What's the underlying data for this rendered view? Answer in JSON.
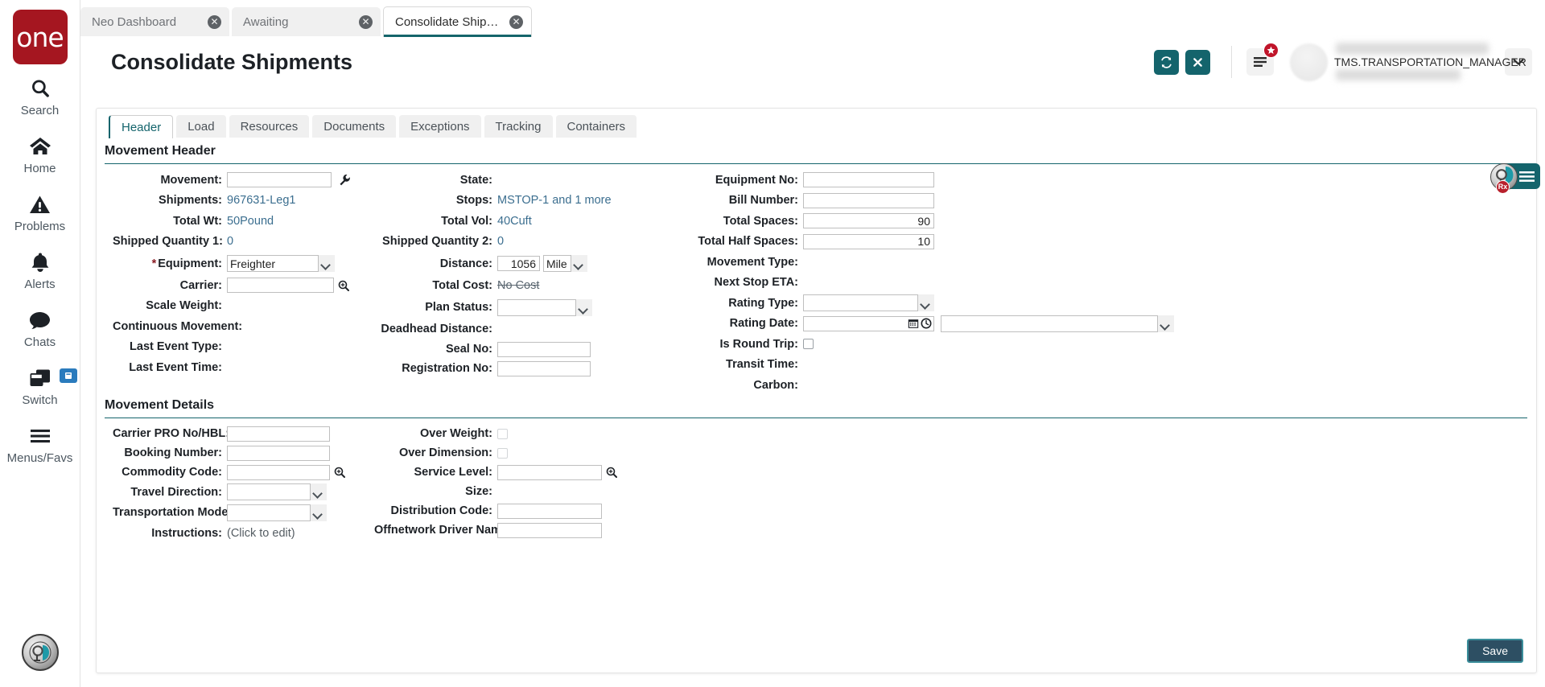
{
  "app": {
    "logo_text": "one",
    "window_title": "Consolidate Shipments"
  },
  "browser_tabs": [
    {
      "label": "Neo Dashboard",
      "active": false,
      "close": "✕"
    },
    {
      "label": "Awaiting",
      "active": false,
      "close": "✕"
    },
    {
      "label": "Consolidate Shipments",
      "active": true,
      "close": "✕"
    }
  ],
  "rail": {
    "items": [
      {
        "label": "Search",
        "icon": "search-icon"
      },
      {
        "label": "Home",
        "icon": "home-icon"
      },
      {
        "label": "Problems",
        "icon": "warning-triangle-icon"
      },
      {
        "label": "Alerts",
        "icon": "bell-icon"
      },
      {
        "label": "Chats",
        "icon": "chat-bubble-icon"
      },
      {
        "label": "Switch",
        "icon": "switch-windows-icon"
      },
      {
        "label": "Menus/Favs",
        "icon": "hamburger-icon"
      }
    ]
  },
  "header": {
    "title": "Consolidate Shipments",
    "refresh_icon": "refresh-icon",
    "close_icon": "close-icon",
    "menu_icon": "list-menu-icon",
    "menu_badge_icon": "star-badge-icon",
    "username": "TMS.TRANSPORTATION_MANAGER",
    "caret_icon": "chevron-down-icon"
  },
  "tabs": [
    {
      "label": "Header",
      "active": true
    },
    {
      "label": "Load",
      "active": false
    },
    {
      "label": "Resources",
      "active": false
    },
    {
      "label": "Documents",
      "active": false
    },
    {
      "label": "Exceptions",
      "active": false
    },
    {
      "label": "Tracking",
      "active": false
    },
    {
      "label": "Containers",
      "active": false
    }
  ],
  "movement_header": {
    "section_title": "Movement Header",
    "col1": {
      "movement_label": "Movement:",
      "movement_value": "",
      "shipments_label": "Shipments:",
      "shipments_value": "967631-Leg1",
      "total_wt_label": "Total Wt:",
      "total_wt_value": "50",
      "total_wt_unit": "Pound",
      "shipped_qty1_label": "Shipped Quantity 1:",
      "shipped_qty1_value": "0",
      "equipment_label": "Equipment:",
      "equipment_required": "*",
      "equipment_value": "Freighter",
      "carrier_label": "Carrier:",
      "carrier_value": "",
      "scale_weight_label": "Scale Weight:",
      "scale_weight_value": "",
      "continuous_movement_label": "Continuous Movement:",
      "continuous_movement_value": "",
      "last_event_type_label": "Last Event Type:",
      "last_event_type_value": "",
      "last_event_time_label": "Last Event Time:",
      "last_event_time_value": ""
    },
    "col2": {
      "state_label": "State:",
      "state_value": "",
      "stops_label": "Stops:",
      "stops_value": "MSTOP-1 and 1 more",
      "total_vol_label": "Total Vol:",
      "total_vol_value": "40",
      "total_vol_unit": "Cuft",
      "shipped_qty2_label": "Shipped Quantity 2:",
      "shipped_qty2_value": "0",
      "distance_label": "Distance:",
      "distance_value": "1056",
      "distance_unit": "Mile",
      "total_cost_label": "Total Cost:",
      "total_cost_value": "No Cost",
      "plan_status_label": "Plan Status:",
      "plan_status_value": "",
      "deadhead_distance_label": "Deadhead Distance:",
      "deadhead_distance_value": "",
      "seal_no_label": "Seal No:",
      "seal_no_value": "",
      "registration_no_label": "Registration No:",
      "registration_no_value": ""
    },
    "col3": {
      "equipment_no_label": "Equipment No:",
      "equipment_no_value": "",
      "bill_number_label": "Bill Number:",
      "bill_number_value": "",
      "total_spaces_label": "Total Spaces:",
      "total_spaces_value": "90",
      "total_half_spaces_label": "Total Half Spaces:",
      "total_half_spaces_value": "10",
      "movement_type_label": "Movement Type:",
      "movement_type_value": "",
      "next_stop_eta_label": "Next Stop ETA:",
      "next_stop_eta_value": "",
      "rating_type_label": "Rating Type:",
      "rating_type_value": "",
      "rating_date_label": "Rating Date:",
      "rating_date_value": "",
      "rating_tz_value": "",
      "is_round_trip_label": "Is Round Trip:",
      "is_round_trip_checked": false,
      "transit_time_label": "Transit Time:",
      "transit_time_value": "",
      "carbon_label": "Carbon:",
      "carbon_value": ""
    }
  },
  "movement_details": {
    "section_title": "Movement Details",
    "col1": {
      "carrier_pro_label": "Carrier PRO No/HBL:",
      "carrier_pro_value": "",
      "booking_number_label": "Booking Number:",
      "booking_number_value": "",
      "commodity_code_label": "Commodity Code:",
      "commodity_code_value": "",
      "travel_direction_label": "Travel Direction:",
      "travel_direction_value": "",
      "transportation_mode_label": "Transportation Mode:",
      "transportation_mode_value": "",
      "instructions_label": "Instructions:",
      "instructions_value": "(Click to edit)"
    },
    "col2": {
      "over_weight_label": "Over Weight:",
      "over_weight_checked": false,
      "over_dimension_label": "Over Dimension:",
      "over_dimension_checked": false,
      "service_level_label": "Service Level:",
      "service_level_value": "",
      "size_label": "Size:",
      "size_value": "",
      "distribution_code_label": "Distribution Code:",
      "distribution_code_value": "",
      "offnetwork_driver_label": "Offnetwork Driver Name:",
      "offnetwork_driver_value": ""
    }
  },
  "footer": {
    "save_label": "Save"
  },
  "assistant": {
    "badge_text": "Rx",
    "menu_icon": "hamburger-icon",
    "avatar_icon": "assistant-avatar-icon"
  },
  "colors": {
    "brand_red": "#a51620",
    "teal": "#14646c",
    "link": "#3b6e8f",
    "save_bg": "#2d4f63",
    "save_border": "#3b8e9b",
    "badge_red": "#c0152a"
  }
}
